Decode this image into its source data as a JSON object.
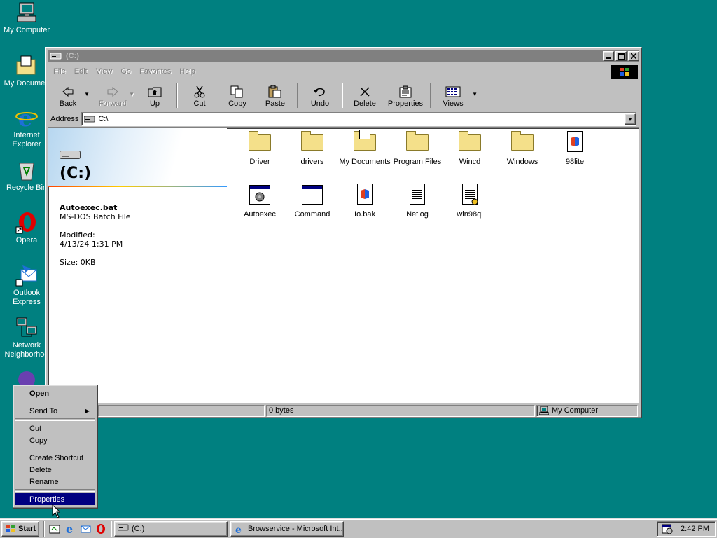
{
  "desktop": {
    "icons": [
      {
        "label": "My Computer"
      },
      {
        "label": "My Documen"
      },
      {
        "label": "Internet Explorer"
      },
      {
        "label": "Recycle Bin"
      },
      {
        "label": "Opera"
      },
      {
        "label": "Outlook Express"
      },
      {
        "label": "Network Neighborhoo"
      }
    ]
  },
  "window": {
    "title": "(C:)",
    "menu": [
      "File",
      "Edit",
      "View",
      "Go",
      "Favorites",
      "Help"
    ],
    "toolbar": {
      "back": "Back",
      "forward": "Forward",
      "up": "Up",
      "cut": "Cut",
      "copy": "Copy",
      "paste": "Paste",
      "undo": "Undo",
      "delete": "Delete",
      "properties": "Properties",
      "views": "Views"
    },
    "address": {
      "label": "Address",
      "value": "C:\\"
    },
    "webview": {
      "drive_title": "(C:)",
      "file_name": "Autoexec.bat",
      "file_type": "MS-DOS Batch File",
      "modified_label": "Modified:",
      "modified_value": "4/13/24 1:31 PM",
      "size": "Size: 0KB"
    },
    "files": [
      {
        "name": "Driver",
        "icon": "folder-icon"
      },
      {
        "name": "drivers",
        "icon": "folder-icon"
      },
      {
        "name": "My Documents",
        "icon": "my-documents-folder-icon"
      },
      {
        "name": "Program Files",
        "icon": "folder-icon"
      },
      {
        "name": "Wincd",
        "icon": "folder-icon"
      },
      {
        "name": "Windows",
        "icon": "folder-icon"
      },
      {
        "name": "98lite",
        "icon": "application-icon"
      },
      {
        "name": "Autoexec",
        "icon": "batch-file-icon"
      },
      {
        "name": "Command",
        "icon": "msdos-program-icon"
      },
      {
        "name": "Io.bak",
        "icon": "system-file-icon"
      },
      {
        "name": "Netlog",
        "icon": "text-document-icon"
      },
      {
        "name": "win98qi",
        "icon": "config-document-icon"
      }
    ],
    "status": {
      "cell1": "",
      "cell2": "0 bytes",
      "cell3": "My Computer"
    }
  },
  "context_menu": {
    "items": [
      "Open",
      "Send To",
      "Cut",
      "Copy",
      "Create Shortcut",
      "Delete",
      "Rename",
      "Properties"
    ]
  },
  "taskbar": {
    "start": "Start",
    "tasks": [
      "(C:)",
      "Browservice - Microsoft Int..."
    ],
    "clock": "2:42 PM"
  }
}
